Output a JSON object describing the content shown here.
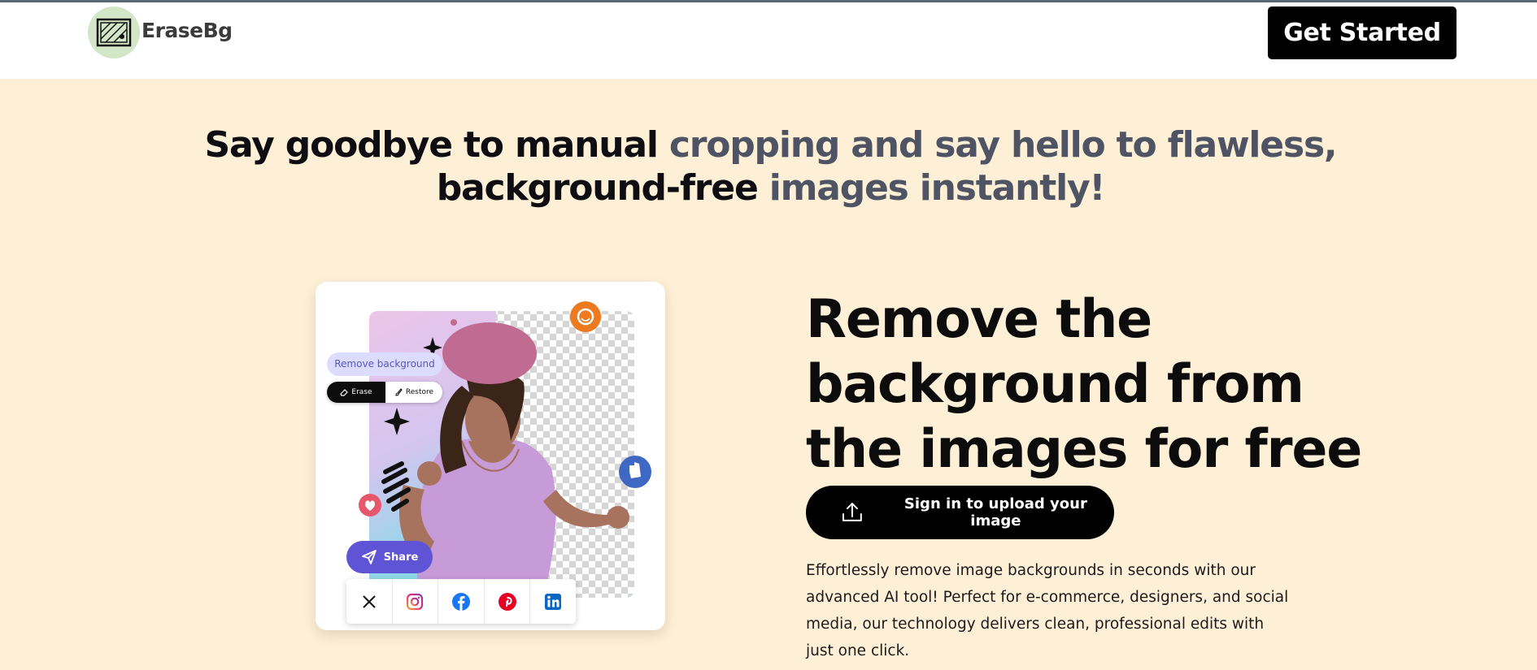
{
  "header": {
    "logo_text": "EraseBg",
    "cta_label": "Get Started"
  },
  "headline": {
    "line1_dark": "Say goodbye to manual",
    "line1_grey": "cropping and say hello to flawless,",
    "line2_dark": "background-free",
    "line2_grey": "images instantly!"
  },
  "card": {
    "remove_label": "Remove background",
    "erase_label": "Erase",
    "restore_label": "Restore",
    "share_label": "Share",
    "socials": [
      "x-icon",
      "instagram-icon",
      "facebook-icon",
      "pinterest-icon",
      "linkedin-icon"
    ]
  },
  "hero": {
    "title": "Remove the background from the images for free",
    "upload_label": "Sign in to upload your image",
    "description": "Effortlessly remove image backgrounds in seconds with our advanced AI tool! Perfect for e-commerce, designers, and social media, our technology delivers clean, professional edits with just one click."
  },
  "colors": {
    "page_bg": "#fef0d6",
    "accent_purple": "#6054d6",
    "grey_text": "#4e5463"
  }
}
